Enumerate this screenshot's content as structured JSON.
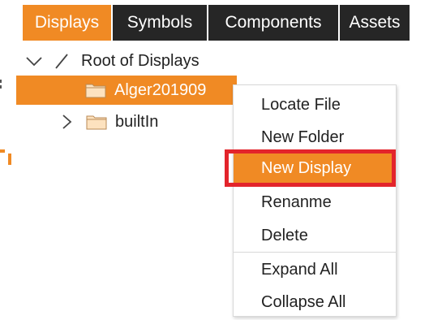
{
  "tabs": [
    {
      "label": "Displays",
      "active": true
    },
    {
      "label": "Symbols",
      "active": false
    },
    {
      "label": "Components",
      "active": false
    },
    {
      "label": "Assets",
      "active": false
    }
  ],
  "tree": {
    "root_label": "Root of Displays",
    "items": [
      {
        "label": "Alger201909",
        "selected": true,
        "icon": "folder-icon"
      },
      {
        "label": "builtIn",
        "selected": false,
        "icon": "folder-icon"
      }
    ]
  },
  "context_menu": {
    "items": [
      {
        "label": "Locate File"
      },
      {
        "label": "New Folder"
      },
      {
        "label": "New Display",
        "highlighted": true
      },
      {
        "label": "Renanme"
      },
      {
        "label": "Delete"
      },
      {
        "label": "Expand All"
      },
      {
        "label": "Collapse All"
      }
    ]
  },
  "colors": {
    "accent": "#f08a24",
    "tab_bg": "#262626",
    "annotation_red": "#e3242b"
  }
}
